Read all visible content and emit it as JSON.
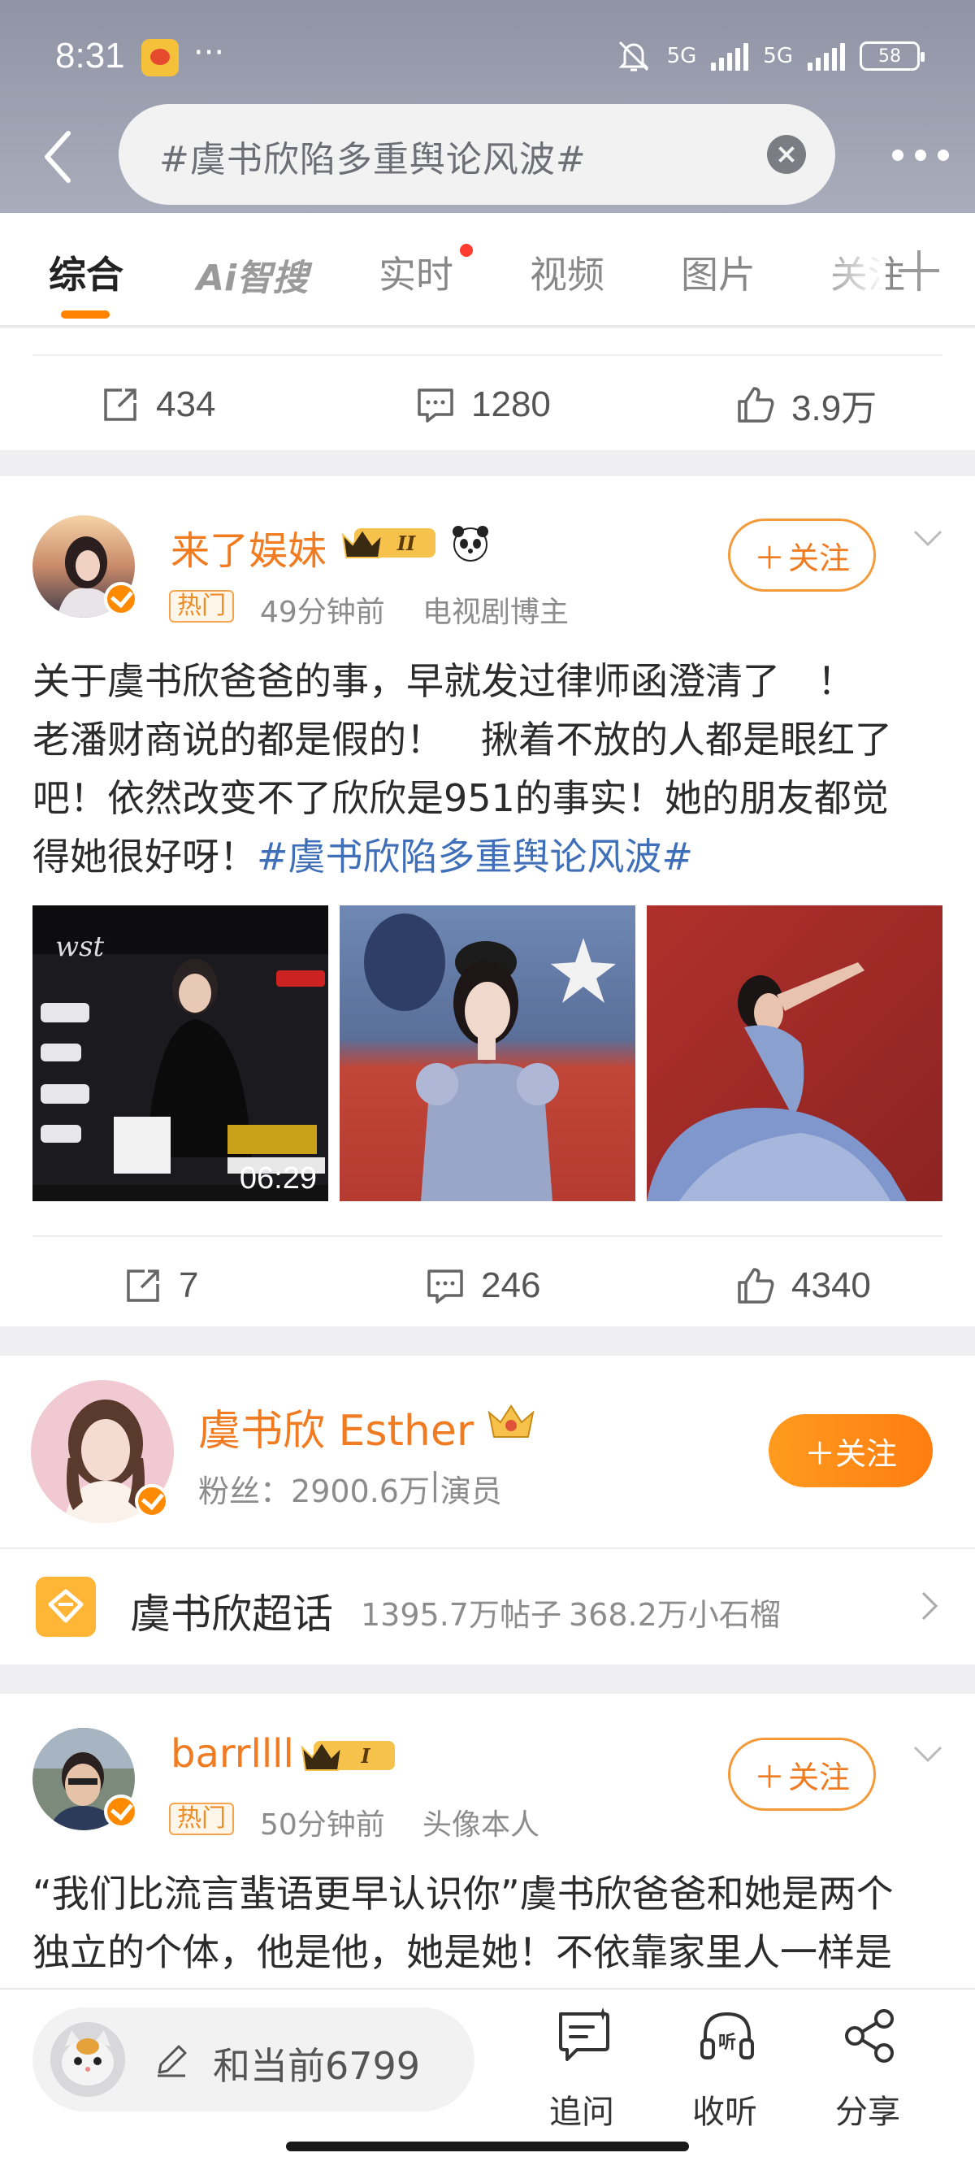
{
  "status_bar": {
    "time": "8:31",
    "more": "···",
    "network1": "5G",
    "network2": "5G",
    "battery": "58"
  },
  "search": {
    "query": "#虞书欣陷多重舆论风波#"
  },
  "tabs": [
    {
      "label": "综合",
      "active": true
    },
    {
      "label": "Ai智搜"
    },
    {
      "label": "实时",
      "has_dot": true
    },
    {
      "label": "视频"
    },
    {
      "label": "图片"
    },
    {
      "label": "关注"
    }
  ],
  "prev_post_actions": {
    "repost": "434",
    "comment": "1280",
    "like": "3.9万"
  },
  "post1": {
    "user": "来了娱妹",
    "level_badge": "II",
    "hot_tag": "热门",
    "time": "49分钟前",
    "role": "电视剧博主",
    "follow_label": "关注",
    "text_lines": [
      "关于虞书欣爸爸的事，早就发过律师函澄清了　！",
      "老潘财商说的都是假的！　揪着不放的人都是眼红了",
      "吧！依然改变不了欣欣是951的事实！她的朋友都觉",
      "得她很好呀！"
    ],
    "hashtag": "#虞书欣陷多重舆论风波#",
    "video_duration": "06:29",
    "actions": {
      "repost": "7",
      "comment": "246",
      "like": "4340"
    }
  },
  "profile": {
    "name": "虞书欣 Esther",
    "fans_label": "粉丝：",
    "fans": "2900.6万",
    "separator": "|",
    "role": "演员",
    "follow_label": "关注",
    "supertopic": "虞书欣超话",
    "posts": "1395.7万帖子",
    "members": "368.2万小石榴"
  },
  "post2": {
    "user": "barrllll",
    "level_badge": "I",
    "hot_tag": "热门",
    "time": "50分钟前",
    "role": "头像本人",
    "follow_label": "关注",
    "text_lines": [
      "“我们比流言蜚语更早认识你”虞书欣爸爸和她是两个",
      "独立的个体，他是他，她是她！不依靠家里人一样是"
    ]
  },
  "bottom_bar": {
    "comment_placeholder": "和当前6799",
    "ask_label": "追问",
    "listen_label": "收听",
    "share_label": "分享"
  },
  "colors": {
    "accent": "#ff8200",
    "username": "#f07b21",
    "hashtag": "#3f6fb8"
  }
}
